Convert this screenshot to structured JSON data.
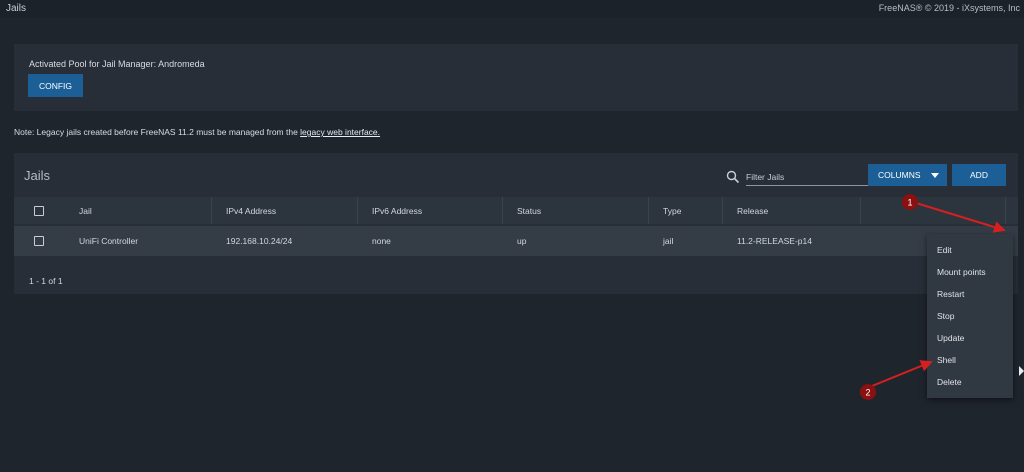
{
  "topbar": {
    "title": "Jails",
    "copyright": "FreeNAS® © 2019 - iXsystems, Inc"
  },
  "config_card": {
    "label": "Activated Pool for Jail Manager: Andromeda",
    "button": "CONFIG"
  },
  "note": {
    "text": "Note: Legacy jails created before FreeNAS 11.2 must be managed from the ",
    "link": "legacy web interface."
  },
  "jails": {
    "title": "Jails",
    "filter_placeholder": "Filter Jails",
    "columns_button": "COLUMNS",
    "add_button": "ADD",
    "headers": [
      "Jail",
      "IPv4 Address",
      "IPv6 Address",
      "Status",
      "Type",
      "Release"
    ],
    "rows": [
      {
        "jail": "UniFi Controller",
        "ipv4": "192.168.10.24/24",
        "ipv6": "none",
        "status": "up",
        "type": "jail",
        "release": "11.2-RELEASE-p14"
      }
    ],
    "pagination": "1 - 1 of 1"
  },
  "context_menu": {
    "items": [
      "Edit",
      "Mount points",
      "Restart",
      "Stop",
      "Update",
      "Shell",
      "Delete"
    ]
  },
  "annotations": {
    "marker_1": "1",
    "marker_2": "2"
  },
  "colors": {
    "accent": "#1b5f96",
    "marker": "#8b1010",
    "background": "#1f252d"
  },
  "icons": {
    "search": "search-icon",
    "dropdown": "caret-down-icon",
    "checkbox": "checkbox-icon"
  }
}
